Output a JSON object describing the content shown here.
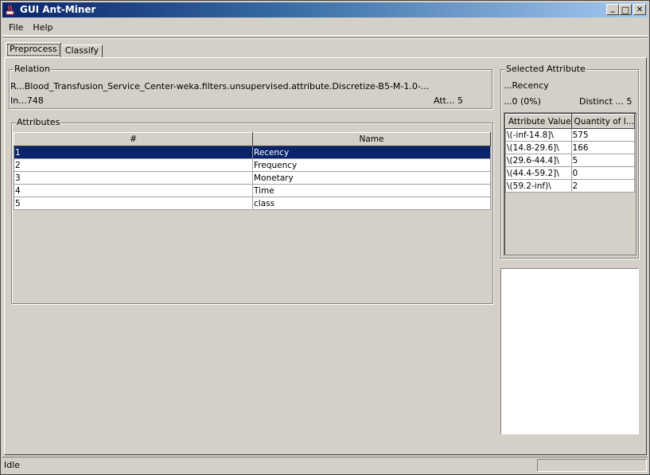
{
  "window": {
    "title": "GUI Ant-Miner",
    "minimize": "_",
    "maximize": "□",
    "close": "✕"
  },
  "menu": [
    "File",
    "Help"
  ],
  "tabs": [
    "Preprocess",
    "Classify"
  ],
  "relation": {
    "legend": "Relation",
    "name": "R...Blood_Transfusion_Service_Center-weka.filters.unsupervised.attribute.Discretize-B5-M-1.0-...",
    "instances": "In...748",
    "attributes": "Att... 5"
  },
  "attributes": {
    "legend": "Attributes",
    "headers": [
      "#",
      "Name"
    ],
    "rows": [
      {
        "num": "1",
        "name": "Recency"
      },
      {
        "num": "2",
        "name": "Frequency"
      },
      {
        "num": "3",
        "name": "Monetary"
      },
      {
        "num": "4",
        "name": "Time"
      },
      {
        "num": "5",
        "name": "class"
      }
    ],
    "selected_index": 0
  },
  "selected_attribute": {
    "legend": "Selected Attribute",
    "name": "...Recency",
    "missing": "...0 (0%)",
    "distinct": "Distinct ... 5",
    "headers": [
      "Attribute Value",
      "Quantity of I..."
    ],
    "rows": [
      {
        "value": "\\(-inf-14.8]\\",
        "qty": "575"
      },
      {
        "value": "\\(14.8-29.6]\\",
        "qty": "166"
      },
      {
        "value": "\\(29.6-44.4]\\",
        "qty": "5"
      },
      {
        "value": "\\(44.4-59.2]\\",
        "qty": "0"
      },
      {
        "value": "\\(59.2-inf)\\",
        "qty": "2"
      }
    ]
  },
  "status": {
    "text": "Idle"
  },
  "colors": {
    "selection": "#0a246a",
    "face": "#d4d0c8",
    "title_start": "#0a246a",
    "title_end": "#a6caf0"
  }
}
